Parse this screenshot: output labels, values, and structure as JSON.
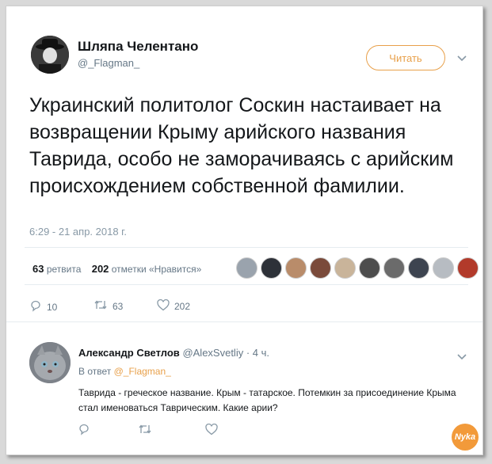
{
  "tweet": {
    "author_name": "Шляпа Челентано",
    "author_handle": "@_Flagman_",
    "follow_label": "Читать",
    "text": "Украинский политолог Соскин настаивает на возвращении Крыму арийского названия Таврида, особо не заморачиваясь с арийским происхождением собственной фамилии.",
    "timestamp": "6:29 - 21 апр. 2018 г.",
    "retweets_count": "63",
    "retweets_label": "ретвита",
    "likes_count": "202",
    "likes_label": "отметки «Нравится»",
    "actions": {
      "reply_count": "10",
      "retweet_count": "63",
      "like_count": "202"
    },
    "liker_colors": [
      "#9aa3ad",
      "#2d3138",
      "#b98c6a",
      "#7a4a3a",
      "#c9b49a",
      "#4d4d4d",
      "#6b6b6b",
      "#3d4450",
      "#b7bcc2",
      "#b23a2a"
    ]
  },
  "reply": {
    "author_name": "Александр Светлов",
    "author_handle": "@AlexSvetliy",
    "time": "· 4 ч.",
    "in_reply_prefix": "В ответ",
    "in_reply_handle": "@_Flagman_",
    "text": "Таврида - греческое название. Крым - татарское. Потемкин за присоединение Крыма стал именоваться Таврическим. Какие арии?"
  },
  "watermark": "Nyka",
  "colors": {
    "accent": "#e8a04a",
    "muted": "#657786",
    "text": "#14171a"
  }
}
